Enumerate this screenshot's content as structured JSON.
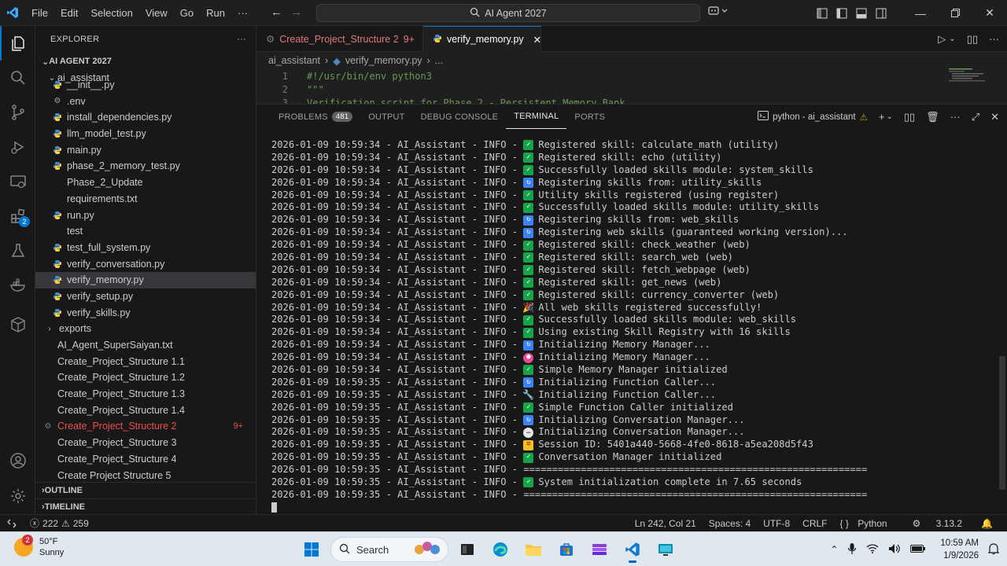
{
  "titlebar": {
    "menu": [
      "File",
      "Edit",
      "Selection",
      "View",
      "Go",
      "Run",
      "···"
    ],
    "search_text": "AI Agent 2027"
  },
  "activity": {
    "extensions_badge": "2"
  },
  "explorer": {
    "header": "EXPLORER",
    "more": "···",
    "root": "AI AGENT 2027",
    "folder": "ai_assistant",
    "files": [
      {
        "name": "__init__.py",
        "type": "py"
      },
      {
        "name": ".env",
        "type": "gear"
      },
      {
        "name": "install_dependencies.py",
        "type": "py"
      },
      {
        "name": "llm_model_test.py",
        "type": "py"
      },
      {
        "name": "main.py",
        "type": "py"
      },
      {
        "name": "phase_2_memory_test.py",
        "type": "py"
      },
      {
        "name": "Phase_2_Update",
        "type": "txt"
      },
      {
        "name": "requirements.txt",
        "type": "txt"
      },
      {
        "name": "run.py",
        "type": "py"
      },
      {
        "name": "test",
        "type": "txt"
      },
      {
        "name": "test_full_system.py",
        "type": "py"
      },
      {
        "name": "verify_conversation.py",
        "type": "py"
      },
      {
        "name": "verify_memory.py",
        "type": "py",
        "selected": true
      },
      {
        "name": "verify_setup.py",
        "type": "py"
      },
      {
        "name": "verify_skills.py",
        "type": "py"
      }
    ],
    "other": [
      {
        "name": "exports",
        "type": "folder"
      },
      {
        "name": "AI_Agent_SuperSaiyan.txt",
        "type": "txt"
      },
      {
        "name": "Create_Project_Structure 1.1",
        "type": "txt"
      },
      {
        "name": "Create_Project_Structure 1.2",
        "type": "txt"
      },
      {
        "name": "Create_Project_Structure 1.3",
        "type": "txt"
      },
      {
        "name": "Create_Project_Structure 1.4",
        "type": "txt"
      },
      {
        "name": "Create_Project_Structure 2",
        "type": "modified",
        "count": "9+"
      },
      {
        "name": "Create_Project_Structure 3",
        "type": "txt"
      },
      {
        "name": "Create_Project_Structure 4",
        "type": "txt"
      },
      {
        "name": "Create Project Structure 5",
        "type": "txt"
      }
    ],
    "outline": "OUTLINE",
    "timeline": "TIMELINE"
  },
  "editor": {
    "tabs": [
      {
        "label": "Create_Project_Structure 2",
        "badge": "9+",
        "active": false
      },
      {
        "label": "verify_memory.py",
        "active": true
      }
    ],
    "breadcrumb": [
      "ai_assistant",
      "verify_memory.py",
      "..."
    ],
    "lines": [
      {
        "n": "1",
        "text": "#!/usr/bin/env python3"
      },
      {
        "n": "2",
        "text": "\"\"\""
      },
      {
        "n": "3",
        "text": "Verification script for Phase 2 - Persistent Memory Bank"
      }
    ]
  },
  "panel": {
    "tabs": [
      {
        "label": "PROBLEMS",
        "badge": "481"
      },
      {
        "label": "OUTPUT"
      },
      {
        "label": "DEBUG CONSOLE"
      },
      {
        "label": "TERMINAL",
        "active": true
      },
      {
        "label": "PORTS"
      }
    ],
    "terminal_name": "python - ai_assistant",
    "log_prefix": " - AI_Assistant - INFO - ",
    "lines": [
      {
        "ts": "2026-01-09 10:59:34",
        "icon": "check",
        "msg": "Registered skill: calculate_math (utility)"
      },
      {
        "ts": "2026-01-09 10:59:34",
        "icon": "check",
        "msg": "Registered skill: echo (utility)"
      },
      {
        "ts": "2026-01-09 10:59:34",
        "icon": "check",
        "msg": "Successfully loaded skills module: system_skills"
      },
      {
        "ts": "2026-01-09 10:59:34",
        "icon": "cycle",
        "msg": "Registering skills from: utility_skills"
      },
      {
        "ts": "2026-01-09 10:59:34",
        "icon": "check",
        "msg": "Utility skills registered (using register)"
      },
      {
        "ts": "2026-01-09 10:59:34",
        "icon": "check",
        "msg": "Successfully loaded skills module: utility_skills"
      },
      {
        "ts": "2026-01-09 10:59:34",
        "icon": "cycle",
        "msg": "Registering skills from: web_skills"
      },
      {
        "ts": "2026-01-09 10:59:34",
        "icon": "cycle",
        "msg": "Registering web skills (guaranteed working version)..."
      },
      {
        "ts": "2026-01-09 10:59:34",
        "icon": "check",
        "msg": "Registered skill: check_weather (web)"
      },
      {
        "ts": "2026-01-09 10:59:34",
        "icon": "check",
        "msg": "Registered skill: search_web (web)"
      },
      {
        "ts": "2026-01-09 10:59:34",
        "icon": "check",
        "msg": "Registered skill: fetch_webpage (web)"
      },
      {
        "ts": "2026-01-09 10:59:34",
        "icon": "check",
        "msg": "Registered skill: get_news (web)"
      },
      {
        "ts": "2026-01-09 10:59:34",
        "icon": "check",
        "msg": "Registered skill: currency_converter (web)"
      },
      {
        "ts": "2026-01-09 10:59:34",
        "icon": "party",
        "msg": "All web skills registered successfully!"
      },
      {
        "ts": "2026-01-09 10:59:34",
        "icon": "check",
        "msg": "Successfully loaded skills module: web_skills"
      },
      {
        "ts": "2026-01-09 10:59:34",
        "icon": "check",
        "msg": "Using existing Skill Registry with 16 skills"
      },
      {
        "ts": "2026-01-09 10:59:34",
        "icon": "cycle",
        "msg": "Initializing Memory Manager..."
      },
      {
        "ts": "2026-01-09 10:59:34",
        "icon": "brain",
        "msg": "Initializing Memory Manager..."
      },
      {
        "ts": "2026-01-09 10:59:34",
        "icon": "check",
        "msg": "Simple Memory Manager initialized"
      },
      {
        "ts": "2026-01-09 10:59:35",
        "icon": "cycle",
        "msg": "Initializing Function Caller..."
      },
      {
        "ts": "2026-01-09 10:59:35",
        "icon": "wrench",
        "msg": "Initializing Function Caller..."
      },
      {
        "ts": "2026-01-09 10:59:35",
        "icon": "check",
        "msg": "Simple Function Caller initialized"
      },
      {
        "ts": "2026-01-09 10:59:35",
        "icon": "cycle",
        "msg": "Initializing Conversation Manager..."
      },
      {
        "ts": "2026-01-09 10:59:35",
        "icon": "speech",
        "msg": "Initializing Conversation Manager..."
      },
      {
        "ts": "2026-01-09 10:59:35",
        "icon": "memo",
        "msg": "Session ID: 5401a440-5668-4fe0-8618-a5ea208d5f43"
      },
      {
        "ts": "2026-01-09 10:59:35",
        "icon": "check",
        "msg": "Conversation Manager initialized"
      },
      {
        "ts": "2026-01-09 10:59:35",
        "icon": "none",
        "msg": "============================================================"
      },
      {
        "ts": "2026-01-09 10:59:35",
        "icon": "check",
        "msg": "System initialization complete in 7.65 seconds"
      },
      {
        "ts": "2026-01-09 10:59:35",
        "icon": "none",
        "msg": "============================================================"
      }
    ]
  },
  "statusbar": {
    "errors": "222",
    "warnings": "259",
    "position": "Ln 242, Col 21",
    "spaces": "Spaces: 4",
    "encoding": "UTF-8",
    "eol": "CRLF",
    "language": "Python",
    "python_version": "3.13.2"
  },
  "taskbar": {
    "weather_temp": "50°F",
    "weather_desc": "Sunny",
    "weather_badge": "2",
    "search_label": "Search",
    "time": "10:59 AM",
    "date": "1/9/2026"
  }
}
